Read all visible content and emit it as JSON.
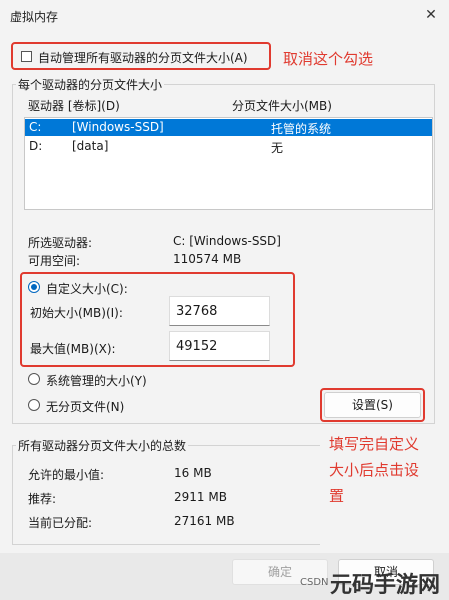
{
  "window": {
    "title": "虚拟内存",
    "close_glyph": "✕"
  },
  "auto_manage": {
    "label": "自动管理所有驱动器的分页文件大小(A)",
    "checked": false
  },
  "annotations": {
    "uncheck_hint": "取消这个勾选",
    "set_hint_line1": "填写完自定义",
    "set_hint_line2": "大小后点击设",
    "set_hint_line3": "置"
  },
  "drives_group": {
    "title": "每个驱动器的分页文件大小",
    "col_drive": "驱动器 [卷标](D)",
    "col_size": "分页文件大小(MB)",
    "rows": [
      {
        "drive": "C:",
        "label": "[Windows-SSD]",
        "size": "托管的系统"
      },
      {
        "drive": "D:",
        "label": "[data]",
        "size": "无"
      }
    ]
  },
  "selected": {
    "drive_label": "所选驱动器:",
    "drive_value": "C:  [Windows-SSD]",
    "space_label": "可用空间:",
    "space_value": "110574 MB"
  },
  "custom": {
    "radio_label": "自定义大小(C):",
    "initial_label": "初始大小(MB)(I):",
    "initial_value": "32768",
    "max_label": "最大值(MB)(X):",
    "max_value": "49152"
  },
  "system_managed_label": "系统管理的大小(Y)",
  "no_paging_label": "无分页文件(N)",
  "set_button": "设置(S)",
  "totals": {
    "title": "所有驱动器分页文件大小的总数",
    "min_label": "允许的最小值:",
    "min_value": "16 MB",
    "rec_label": "推荐:",
    "rec_value": "2911 MB",
    "cur_label": "当前已分配:",
    "cur_value": "27161 MB"
  },
  "ok_button": "确定",
  "cancel_button": "取消",
  "watermark": {
    "small": "CSDN",
    "big": "元码手游网"
  },
  "colors": {
    "accent": "#0078d7",
    "annotation": "#e03a2f"
  }
}
